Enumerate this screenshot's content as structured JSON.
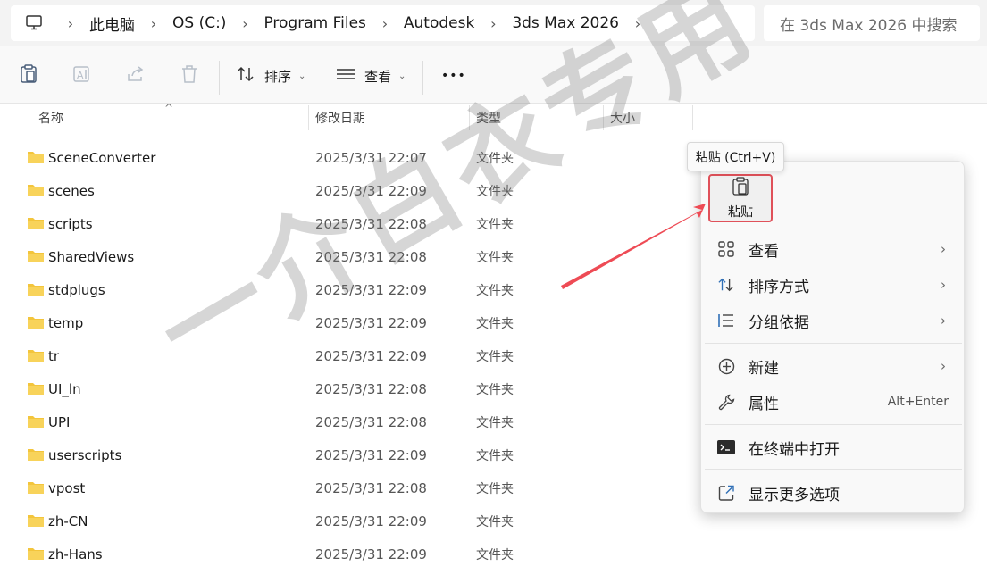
{
  "breadcrumb": [
    "此电脑",
    "OS (C:)",
    "Program Files",
    "Autodesk",
    "3ds Max 2026"
  ],
  "search": {
    "placeholder": "在 3ds Max 2026 中搜索"
  },
  "toolbar": {
    "sort_label": "排序",
    "view_label": "查看",
    "more_label": "•••"
  },
  "columns": {
    "name": "名称",
    "date": "修改日期",
    "type": "类型",
    "size": "大小"
  },
  "files": [
    {
      "name": "SceneConverter",
      "date": "2025/3/31 22:07",
      "type": "文件夹"
    },
    {
      "name": "scenes",
      "date": "2025/3/31 22:09",
      "type": "文件夹"
    },
    {
      "name": "scripts",
      "date": "2025/3/31 22:08",
      "type": "文件夹"
    },
    {
      "name": "SharedViews",
      "date": "2025/3/31 22:08",
      "type": "文件夹"
    },
    {
      "name": "stdplugs",
      "date": "2025/3/31 22:09",
      "type": "文件夹"
    },
    {
      "name": "temp",
      "date": "2025/3/31 22:09",
      "type": "文件夹"
    },
    {
      "name": "tr",
      "date": "2025/3/31 22:09",
      "type": "文件夹"
    },
    {
      "name": "UI_ln",
      "date": "2025/3/31 22:08",
      "type": "文件夹"
    },
    {
      "name": "UPI",
      "date": "2025/3/31 22:08",
      "type": "文件夹"
    },
    {
      "name": "userscripts",
      "date": "2025/3/31 22:09",
      "type": "文件夹"
    },
    {
      "name": "vpost",
      "date": "2025/3/31 22:08",
      "type": "文件夹"
    },
    {
      "name": "zh-CN",
      "date": "2025/3/31 22:09",
      "type": "文件夹"
    },
    {
      "name": "zh-Hans",
      "date": "2025/3/31 22:09",
      "type": "文件夹"
    }
  ],
  "context_menu": {
    "tooltip": "粘贴 (Ctrl+V)",
    "paste_label": "粘贴",
    "items": [
      {
        "label": "查看",
        "icon": "grid-icon",
        "submenu": true
      },
      {
        "label": "排序方式",
        "icon": "sort-icon",
        "submenu": true
      },
      {
        "label": "分组依据",
        "icon": "list-icon",
        "submenu": true
      },
      {
        "label": "新建",
        "icon": "plus-circle-icon",
        "submenu": true
      },
      {
        "label": "属性",
        "icon": "wrench-icon",
        "shortcut": "Alt+Enter"
      },
      {
        "label": "在终端中打开",
        "icon": "terminal-icon"
      },
      {
        "label": "显示更多选项",
        "icon": "external-icon"
      }
    ],
    "arrow_glyph": "›"
  },
  "watermark": "一介白衣专用",
  "colors": {
    "folder": "#f3c53c",
    "highlight_border": "#e0515a",
    "arrow": "#ee4b55"
  }
}
